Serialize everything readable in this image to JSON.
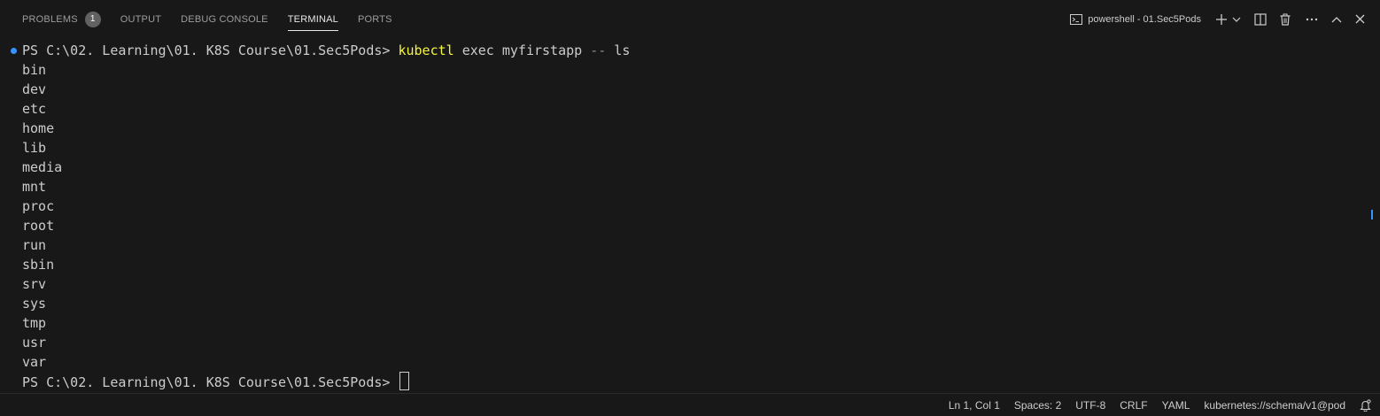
{
  "panel": {
    "tabs": [
      {
        "label": "PROBLEMS",
        "badge": "1"
      },
      {
        "label": "OUTPUT"
      },
      {
        "label": "DEBUG CONSOLE"
      },
      {
        "label": "TERMINAL",
        "active": true
      },
      {
        "label": "PORTS"
      }
    ],
    "terminal_name": "powershell - 01.Sec5Pods",
    "action_icons": [
      "terminal-icon",
      "plus-icon",
      "chevron-down-icon",
      "split-icon",
      "trash-icon",
      "more-icon",
      "maximize-icon",
      "close-icon"
    ]
  },
  "terminal": {
    "prompt": "PS C:\\02. Learning\\01. K8S Course\\01.Sec5Pods>",
    "command": {
      "program": "kubectl",
      "args": "exec myfirstapp",
      "flag": "--",
      "rest": "ls"
    },
    "output": [
      "bin",
      "dev",
      "etc",
      "home",
      "lib",
      "media",
      "mnt",
      "proc",
      "root",
      "run",
      "sbin",
      "srv",
      "sys",
      "tmp",
      "usr",
      "var"
    ],
    "final_prompt": "PS C:\\02. Learning\\01. K8S Course\\01.Sec5Pods>"
  },
  "status": {
    "position": "Ln 1, Col 1",
    "spaces": "Spaces: 2",
    "encoding": "UTF-8",
    "eol": "CRLF",
    "language": "YAML",
    "schema": "kubernetes://schema/v1@pod",
    "notifications_icon": "bell-icon"
  },
  "colors": {
    "background": "#181818",
    "accent": "#3794ff",
    "command": "#f5f543"
  }
}
